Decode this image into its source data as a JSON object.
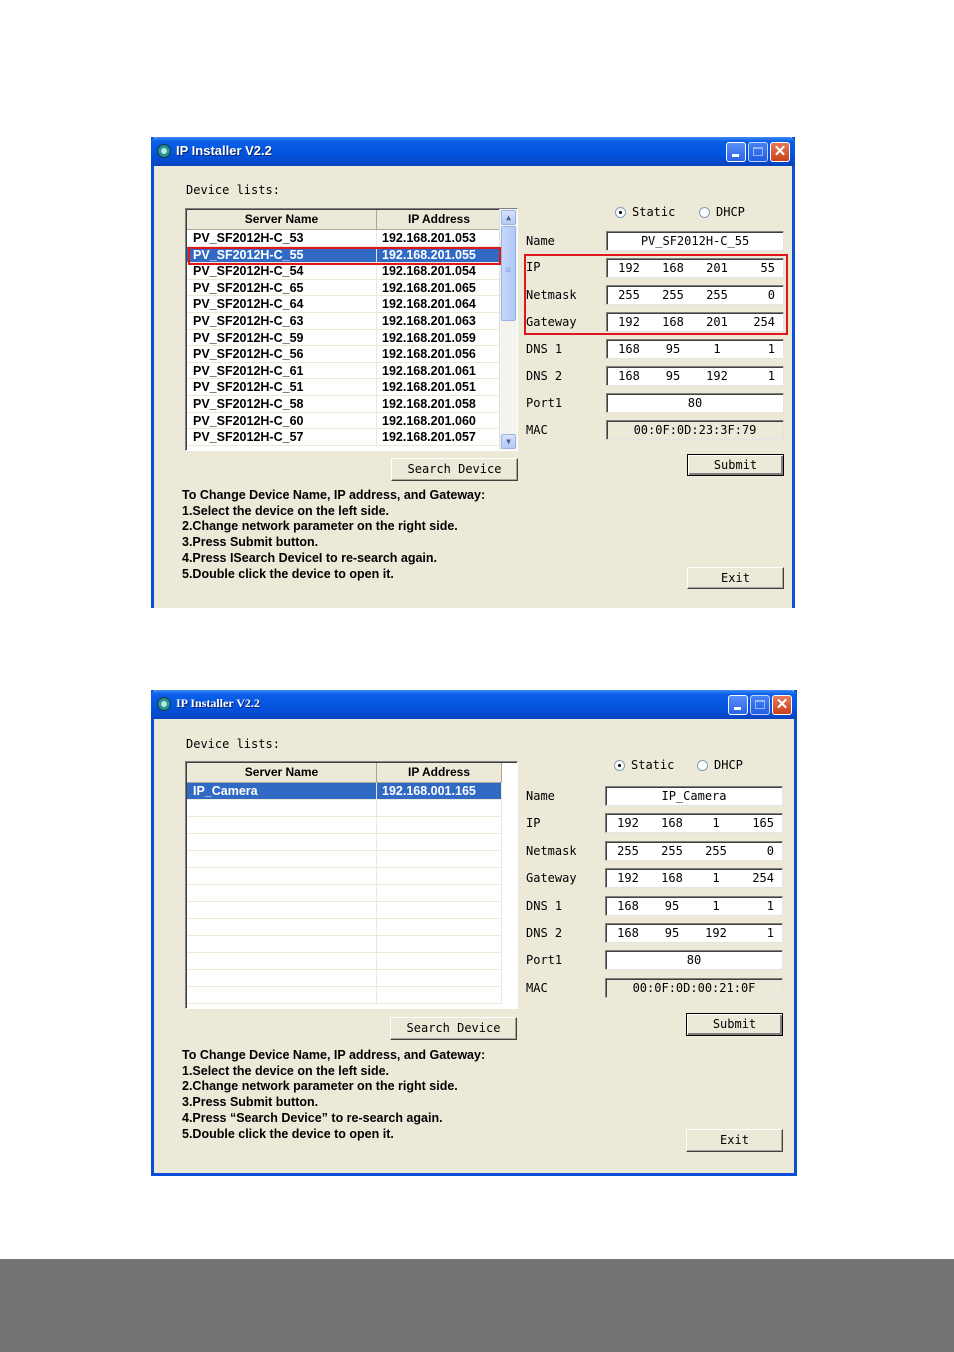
{
  "windows": [
    {
      "title": "IP Installer V2.2",
      "device_list_label": "Device lists:",
      "columns": [
        "Server Name",
        "IP Address"
      ],
      "rows": [
        {
          "name": "PV_SF2012H-C_53",
          "ip": "192.168.201.053"
        },
        {
          "name": "PV_SF2012H-C_55",
          "ip": "192.168.201.055",
          "selected": true
        },
        {
          "name": "PV_SF2012H-C_54",
          "ip": "192.168.201.054"
        },
        {
          "name": "PV_SF2012H-C_65",
          "ip": "192.168.201.065"
        },
        {
          "name": "PV_SF2012H-C_64",
          "ip": "192.168.201.064"
        },
        {
          "name": "PV_SF2012H-C_63",
          "ip": "192.168.201.063"
        },
        {
          "name": "PV_SF2012H-C_59",
          "ip": "192.168.201.059"
        },
        {
          "name": "PV_SF2012H-C_56",
          "ip": "192.168.201.056"
        },
        {
          "name": "PV_SF2012H-C_61",
          "ip": "192.168.201.061"
        },
        {
          "name": "PV_SF2012H-C_51",
          "ip": "192.168.201.051"
        },
        {
          "name": "PV_SF2012H-C_58",
          "ip": "192.168.201.058"
        },
        {
          "name": "PV_SF2012H-C_60",
          "ip": "192.168.201.060"
        },
        {
          "name": "PV_SF2012H-C_57",
          "ip": "192.168.201.057"
        }
      ],
      "search_button": "Search Device",
      "mode": {
        "static_label": "Static",
        "dhcp_label": "DHCP",
        "selected": "Static"
      },
      "labels": {
        "name": "Name",
        "ip": "IP",
        "netmask": "Netmask",
        "gateway": "Gateway",
        "dns1": "DNS 1",
        "dns2": "DNS 2",
        "port": "Port1",
        "mac": "MAC"
      },
      "values": {
        "name": "PV_SF2012H-C_55",
        "ip": [
          "192",
          "168",
          "201",
          "55"
        ],
        "netmask": [
          "255",
          "255",
          "255",
          "0"
        ],
        "gateway": [
          "192",
          "168",
          "201",
          "254"
        ],
        "dns1": [
          "168",
          "95",
          "1",
          "1"
        ],
        "dns2": [
          "168",
          "95",
          "192",
          "1"
        ],
        "port": "80",
        "mac": "00:0F:0D:23:3F:79"
      },
      "submit_button": "Submit",
      "exit_button": "Exit",
      "help_lines": [
        "To Change Device Name, IP address, and Gateway:",
        "1.Select the device on the left side.",
        "2.Change network parameter on the right side.",
        "3.Press Submit button.",
        "4.Press ISearch DeviceI to re-search again.",
        "5.Double click the device to open it."
      ]
    },
    {
      "title": "IP Installer V2.2",
      "device_list_label": "Device lists:",
      "columns": [
        "Server Name",
        "IP Address"
      ],
      "rows": [
        {
          "name": "IP_Camera",
          "ip": "192.168.001.165",
          "selected": true
        }
      ],
      "search_button": "Search Device",
      "mode": {
        "static_label": "Static",
        "dhcp_label": "DHCP",
        "selected": "Static"
      },
      "labels": {
        "name": "Name",
        "ip": "IP",
        "netmask": "Netmask",
        "gateway": "Gateway",
        "dns1": "DNS 1",
        "dns2": "DNS 2",
        "port": "Port1",
        "mac": "MAC"
      },
      "values": {
        "name": "IP_Camera",
        "ip": [
          "192",
          "168",
          "1",
          "165"
        ],
        "netmask": [
          "255",
          "255",
          "255",
          "0"
        ],
        "gateway": [
          "192",
          "168",
          "1",
          "254"
        ],
        "dns1": [
          "168",
          "95",
          "1",
          "1"
        ],
        "dns2": [
          "168",
          "95",
          "192",
          "1"
        ],
        "port": "80",
        "mac": "00:0F:0D:00:21:0F"
      },
      "submit_button": "Submit",
      "exit_button": "Exit",
      "help_lines": [
        "To Change Device Name, IP address, and Gateway:",
        "1.Select the device on the left side.",
        "2.Change network parameter on the right side.",
        "3.Press Submit button.",
        "4.Press “Search Device” to re-search again.",
        "5.Double click the device to open it."
      ]
    }
  ],
  "highlight_color": "#e0161c",
  "selection_color": "#316ac5"
}
